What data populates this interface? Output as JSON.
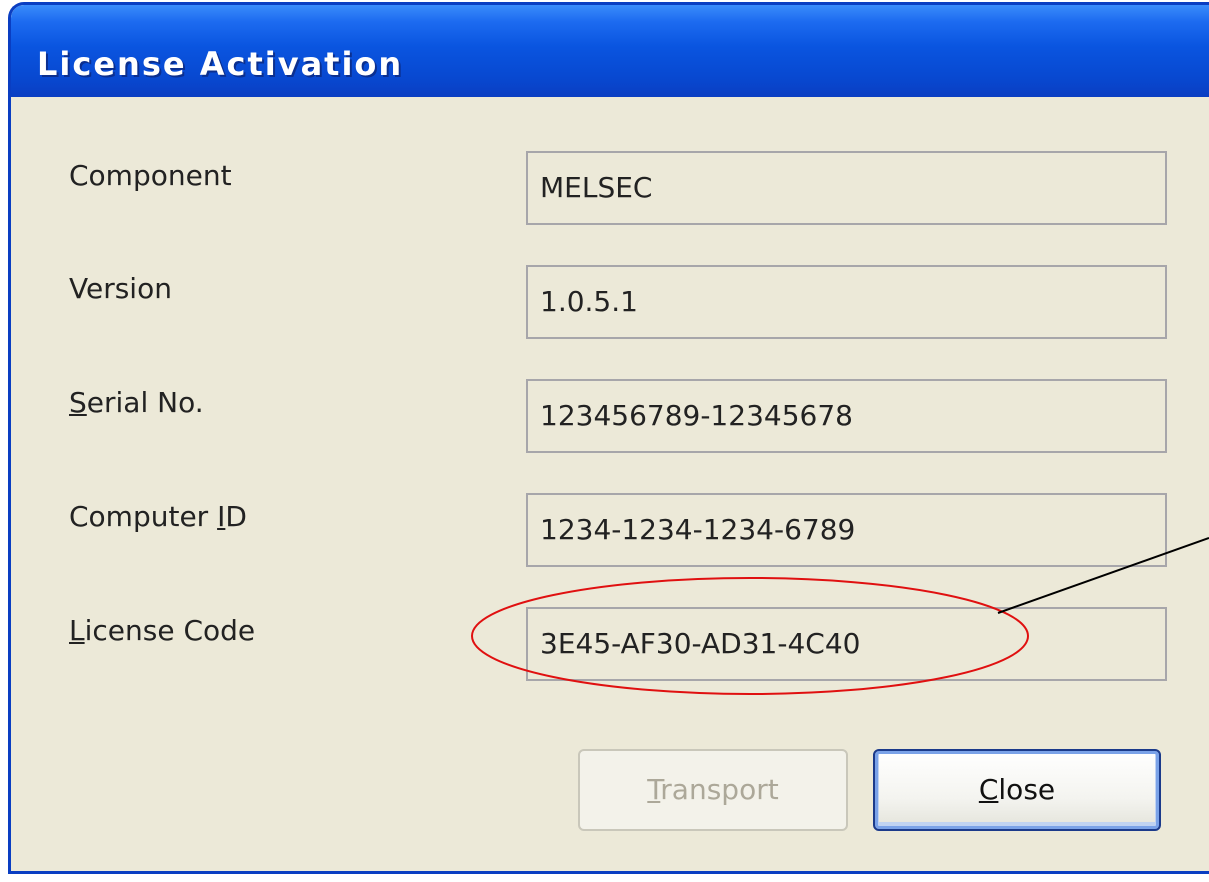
{
  "window": {
    "title": "License Activation"
  },
  "fields": [
    {
      "label": "Component",
      "value": "MELSEC",
      "mnemonic": ""
    },
    {
      "label_prefix": "",
      "label_key": "S",
      "label_rest": "erial No.",
      "value": "123456789-12345678"
    },
    {
      "label": "Version",
      "value": "1.0.5.1"
    },
    {
      "label_prefix": "Computer ",
      "label_key": "I",
      "label_rest": "D",
      "value": "1234-1234-1234-6789"
    },
    {
      "label_prefix": "",
      "label_key": "L",
      "label_rest": "icense Code",
      "value": "3E45-AF30-AD31-4C40"
    }
  ],
  "component": {
    "label": "Component",
    "value": "MELSEC"
  },
  "version": {
    "label": "Version",
    "value": "1.0.5.1"
  },
  "serial": {
    "label_key": "S",
    "label_rest": "erial No.",
    "value": "123456789-12345678"
  },
  "computer_id": {
    "label_prefix": "Computer ",
    "label_key": "I",
    "label_rest": "D",
    "value": "1234-1234-1234-6789"
  },
  "license_code": {
    "label_key": "L",
    "label_rest": "icense Code",
    "value": "3E45-AF30-AD31-4C40"
  },
  "buttons": {
    "transport": {
      "key": "T",
      "rest": "ransport",
      "enabled": false
    },
    "close": {
      "key": "C",
      "rest": "lose",
      "enabled": true
    }
  },
  "annotation": {
    "highlight_color": "#e01010",
    "pointer_color": "#000000"
  },
  "colors": {
    "titlebar": "#0a55e0",
    "dialog_bg": "#ece9d8",
    "field_border": "#a7a6aa",
    "disabled_text": "#aca899"
  }
}
